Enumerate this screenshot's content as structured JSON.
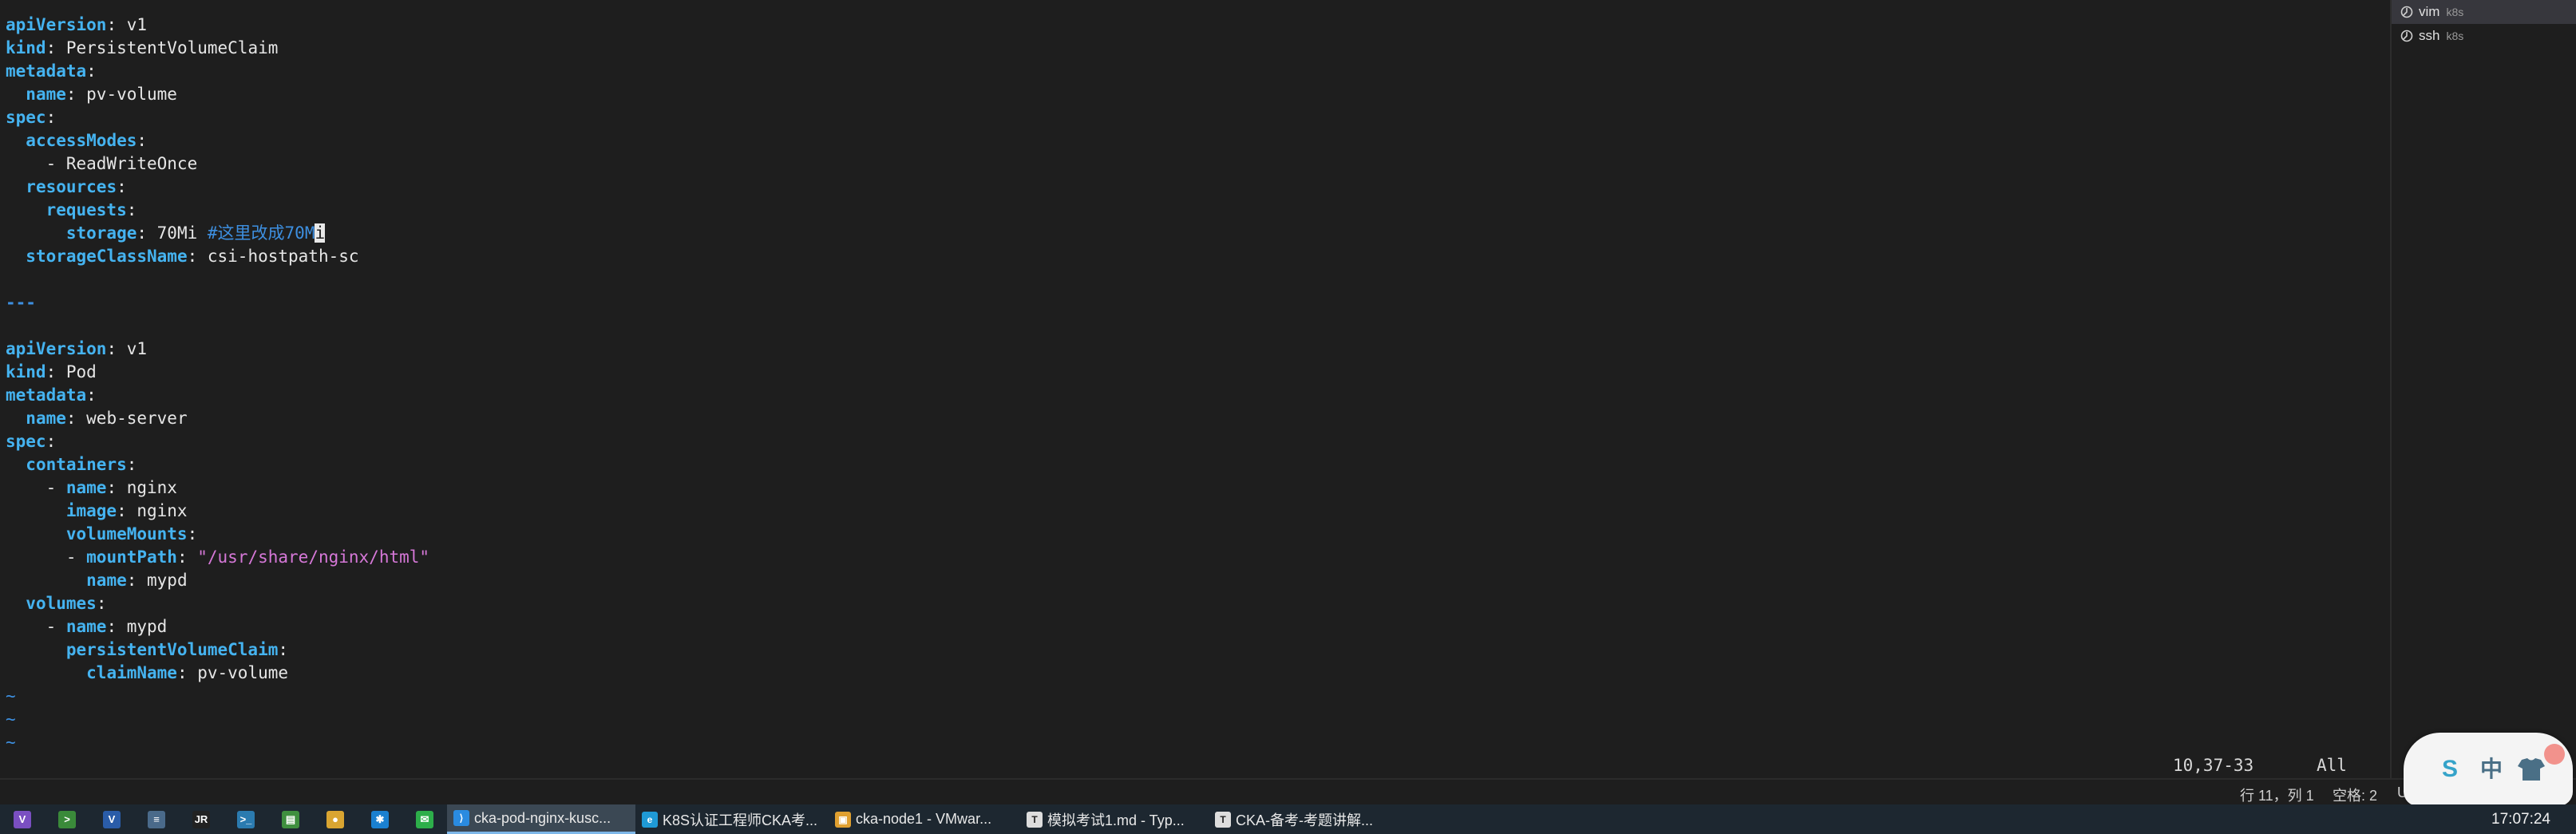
{
  "editor": {
    "lines": [
      [
        {
          "t": "apiVersion",
          "c": "key"
        },
        {
          "t": ": v1"
        }
      ],
      [
        {
          "t": "kind",
          "c": "key"
        },
        {
          "t": ": PersistentVolumeClaim"
        }
      ],
      [
        {
          "t": "metadata",
          "c": "key"
        },
        {
          "t": ":"
        }
      ],
      [
        {
          "t": "  "
        },
        {
          "t": "name",
          "c": "key"
        },
        {
          "t": ": pv-volume"
        }
      ],
      [
        {
          "t": "spec",
          "c": "key"
        },
        {
          "t": ":"
        }
      ],
      [
        {
          "t": "  "
        },
        {
          "t": "accessModes",
          "c": "key"
        },
        {
          "t": ":"
        }
      ],
      [
        {
          "t": "    - ReadWriteOnce"
        }
      ],
      [
        {
          "t": "  "
        },
        {
          "t": "resources",
          "c": "key"
        },
        {
          "t": ":"
        }
      ],
      [
        {
          "t": "    "
        },
        {
          "t": "requests",
          "c": "key"
        },
        {
          "t": ":"
        }
      ],
      [
        {
          "t": "      "
        },
        {
          "t": "storage",
          "c": "key"
        },
        {
          "t": ": 70Mi "
        },
        {
          "t": "#这里改成70M",
          "c": "cmt"
        },
        {
          "t": "i",
          "c": "cursor"
        }
      ],
      [
        {
          "t": "  "
        },
        {
          "t": "storageClassName",
          "c": "key"
        },
        {
          "t": ": csi-hostpath-sc"
        }
      ],
      [
        {
          "t": ""
        }
      ],
      [
        {
          "t": "---",
          "c": "sep"
        }
      ],
      [
        {
          "t": ""
        }
      ],
      [
        {
          "t": "apiVersion",
          "c": "key"
        },
        {
          "t": ": v1"
        }
      ],
      [
        {
          "t": "kind",
          "c": "key"
        },
        {
          "t": ": Pod"
        }
      ],
      [
        {
          "t": "metadata",
          "c": "key"
        },
        {
          "t": ":"
        }
      ],
      [
        {
          "t": "  "
        },
        {
          "t": "name",
          "c": "key"
        },
        {
          "t": ": web-server"
        }
      ],
      [
        {
          "t": "spec",
          "c": "key"
        },
        {
          "t": ":"
        }
      ],
      [
        {
          "t": "  "
        },
        {
          "t": "containers",
          "c": "key"
        },
        {
          "t": ":"
        }
      ],
      [
        {
          "t": "    - "
        },
        {
          "t": "name",
          "c": "key"
        },
        {
          "t": ": nginx"
        }
      ],
      [
        {
          "t": "      "
        },
        {
          "t": "image",
          "c": "key"
        },
        {
          "t": ": nginx"
        }
      ],
      [
        {
          "t": "      "
        },
        {
          "t": "volumeMounts",
          "c": "key"
        },
        {
          "t": ":"
        }
      ],
      [
        {
          "t": "      - "
        },
        {
          "t": "mountPath",
          "c": "key"
        },
        {
          "t": ": "
        },
        {
          "t": "\"/usr/share/nginx/html\"",
          "c": "str"
        }
      ],
      [
        {
          "t": "        "
        },
        {
          "t": "name",
          "c": "key"
        },
        {
          "t": ": mypd"
        }
      ],
      [
        {
          "t": "  "
        },
        {
          "t": "volumes",
          "c": "key"
        },
        {
          "t": ":"
        }
      ],
      [
        {
          "t": "    - "
        },
        {
          "t": "name",
          "c": "key"
        },
        {
          "t": ": mypd"
        }
      ],
      [
        {
          "t": "      "
        },
        {
          "t": "persistentVolumeClaim",
          "c": "key"
        },
        {
          "t": ":"
        }
      ],
      [
        {
          "t": "        "
        },
        {
          "t": "claimName",
          "c": "key"
        },
        {
          "t": ": pv-volume"
        }
      ],
      [
        {
          "t": "~",
          "c": "tilde"
        }
      ],
      [
        {
          "t": "~",
          "c": "tilde"
        }
      ],
      [
        {
          "t": "~",
          "c": "tilde"
        }
      ]
    ],
    "ruler": "10,37-33",
    "scroll_mode": "All"
  },
  "side_panel": {
    "processes": [
      {
        "name": "vim",
        "sub": "k8s",
        "active": true
      },
      {
        "name": "ssh",
        "sub": "k8s",
        "active": false
      }
    ]
  },
  "status_bar": {
    "position": "行 11，列 1",
    "spaces": "空格: 2",
    "encoding": "U"
  },
  "ime": {
    "logo_letter": "S",
    "mode": "中"
  },
  "taskbar": {
    "pinned_icons": [
      {
        "name": "visual-studio-icon",
        "glyph": "V",
        "color": "#7a4fc1"
      },
      {
        "name": "terminal-green-icon",
        "glyph": ">",
        "color": "#3a8a3a"
      },
      {
        "name": "visio-icon",
        "glyph": "V",
        "color": "#2a5ca8"
      },
      {
        "name": "app-manager-icon",
        "glyph": "≡",
        "color": "#4a6a8a"
      },
      {
        "name": "jetbrains-icon",
        "glyph": "JR",
        "color": "#222222"
      },
      {
        "name": "powershell-icon",
        "glyph": ">_",
        "color": "#2b7bb0"
      },
      {
        "name": "notepad-icon",
        "glyph": "▤",
        "color": "#3f8f3f"
      },
      {
        "name": "chrome-icon",
        "glyph": "●",
        "color": "#d9a531"
      },
      {
        "name": "snowflake-app-icon",
        "glyph": "✱",
        "color": "#1a80d0"
      },
      {
        "name": "wechat-icon",
        "glyph": "✉",
        "color": "#2dae4a"
      }
    ],
    "apps": [
      {
        "name": "vscode-window",
        "label": "cka-pod-nginx-kusc...",
        "glyph": "⟩",
        "color": "#2a8be0",
        "active": true
      },
      {
        "name": "edge-window",
        "label": "K8S认证工程师CKA考...",
        "glyph": "e",
        "color": "#1f9ad6",
        "active": false
      },
      {
        "name": "vmware-window",
        "label": "cka-node1 - VMwar...",
        "glyph": "▣",
        "color": "#e0a030",
        "active": false
      },
      {
        "name": "typora-window",
        "label": "模拟考试1.md - Typ...",
        "glyph": "T",
        "color": "#dddddd",
        "active": false
      },
      {
        "name": "typora-window-2",
        "label": "CKA-备考-考题讲解...",
        "glyph": "T",
        "color": "#dddddd",
        "active": false
      }
    ],
    "clock": "17:07:24"
  }
}
